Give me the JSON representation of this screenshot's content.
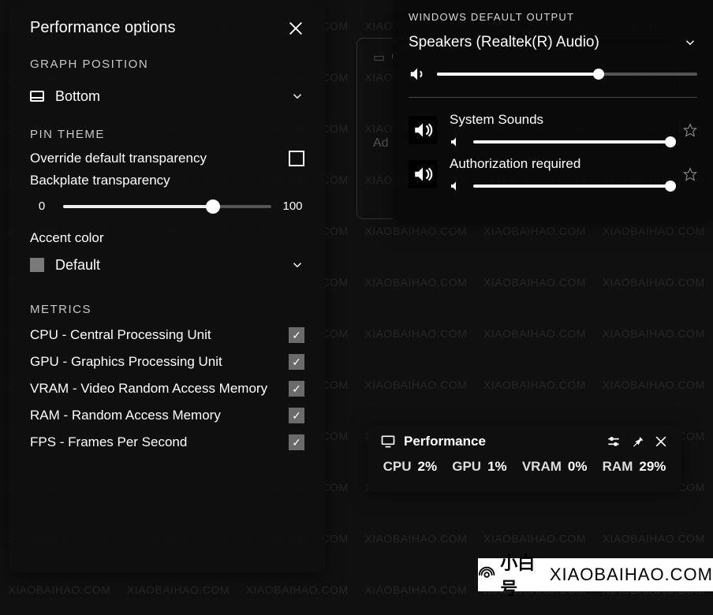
{
  "watermark": "XIAOBAIHAO.COM",
  "opts": {
    "title": "Performance options",
    "graph_position_label": "GRAPH POSITION",
    "graph_position_value": "Bottom",
    "pin_theme_label": "PIN THEME",
    "override_label": "Override default transparency",
    "override_checked": false,
    "backplate_label": "Backplate transparency",
    "slider_min": "0",
    "slider_max": "100",
    "slider_pct": 72,
    "accent_label": "Accent color",
    "accent_value": "Default",
    "metrics_label": "METRICS",
    "metrics": [
      {
        "label": "CPU - Central Processing Unit",
        "checked": true
      },
      {
        "label": "GPU - Graphics Processing Unit",
        "checked": true
      },
      {
        "label": "VRAM - Video Random Access Memory",
        "checked": true
      },
      {
        "label": "RAM - Random Access Memory",
        "checked": true
      },
      {
        "label": "FPS - Frames Per Second",
        "checked": true
      }
    ]
  },
  "audio": {
    "section_label": "WINDOWS DEFAULT OUTPUT",
    "device": "Speakers (Realtek(R) Audio)",
    "master_volume_pct": 62,
    "apps": [
      {
        "name": "System Sounds",
        "volume_pct": 100
      },
      {
        "name": "Authorization required",
        "volume_pct": 100
      }
    ]
  },
  "bg_widget": {
    "title": "C",
    "add_label": "Ad"
  },
  "perf": {
    "title": "Performance",
    "stats": [
      {
        "k": "CPU",
        "v": "2%"
      },
      {
        "k": "GPU",
        "v": "1%"
      },
      {
        "k": "VRAM",
        "v": "0%"
      },
      {
        "k": "RAM",
        "v": "29%"
      }
    ]
  },
  "badge": {
    "cn": "小白号",
    "en": "XIAOBAIHAO.COM"
  }
}
